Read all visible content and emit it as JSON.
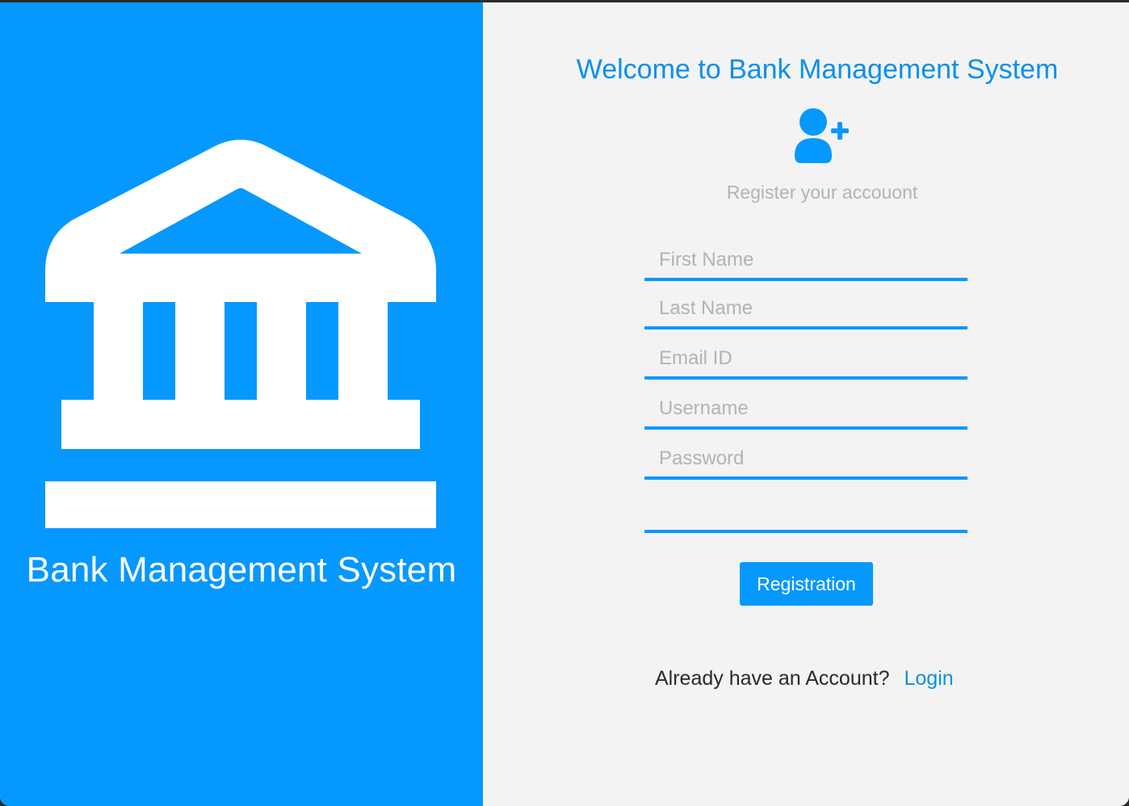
{
  "left_panel": {
    "brand_title": "Bank Management System",
    "logo_icon": "bank-building-icon",
    "background_color": "#0598fe"
  },
  "form": {
    "welcome_title": "Welcome to Bank Management System",
    "user_icon": "add-user-icon",
    "subtitle": "Register your accouont",
    "fields": {
      "first_name": {
        "placeholder": "First Name",
        "value": ""
      },
      "last_name": {
        "placeholder": "Last Name",
        "value": ""
      },
      "email": {
        "placeholder": "Email ID",
        "value": ""
      },
      "username": {
        "placeholder": "Username",
        "value": ""
      },
      "password": {
        "placeholder": "Password",
        "value": ""
      },
      "extra": {
        "placeholder": "",
        "value": ""
      }
    },
    "register_button_label": "Registration",
    "login_prompt": "Already have an Account?",
    "login_link_label": "Login"
  },
  "colors": {
    "accent": "#0598fe",
    "title": "#0a8fef",
    "placeholder": "#b3b3b3",
    "background": "#f3f3f3"
  }
}
